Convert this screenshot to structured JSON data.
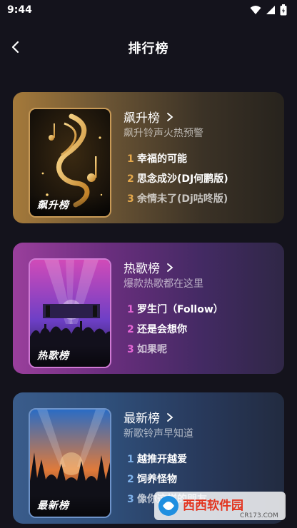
{
  "status_bar": {
    "time": "9:44",
    "icons": [
      "wifi-icon",
      "signal-icon",
      "battery-icon"
    ]
  },
  "header": {
    "title": "排行榜",
    "back_icon": "chevron-left-icon"
  },
  "charts": [
    {
      "title": "飙升榜",
      "subtitle": "飙升铃声火热预警",
      "cover_label": "飙升榜",
      "accent": "#e5a94d",
      "songs": [
        {
          "rank": "1",
          "name": "幸福的可能"
        },
        {
          "rank": "2",
          "name": "思念成沙(DJ何鹏版)"
        },
        {
          "rank": "3",
          "name": "余情未了(Dj咕咚版)"
        }
      ]
    },
    {
      "title": "热歌榜",
      "subtitle": "爆款热歌都在这里",
      "cover_label": "热歌榜",
      "accent": "#e667d6",
      "songs": [
        {
          "rank": "1",
          "name": "罗生门（Follow）"
        },
        {
          "rank": "2",
          "name": "还是会想你"
        },
        {
          "rank": "3",
          "name": "如果呢"
        }
      ]
    },
    {
      "title": "最新榜",
      "subtitle": "新歌铃声早知道",
      "cover_label": "最新榜",
      "accent": "#7fb2ea",
      "songs": [
        {
          "rank": "1",
          "name": "越推开越爱"
        },
        {
          "rank": "2",
          "name": "饲养怪物"
        },
        {
          "rank": "3",
          "name": "像你这样的朋友"
        }
      ]
    }
  ],
  "watermark": {
    "brand": "西西软件园",
    "url": "CR173.COM"
  }
}
